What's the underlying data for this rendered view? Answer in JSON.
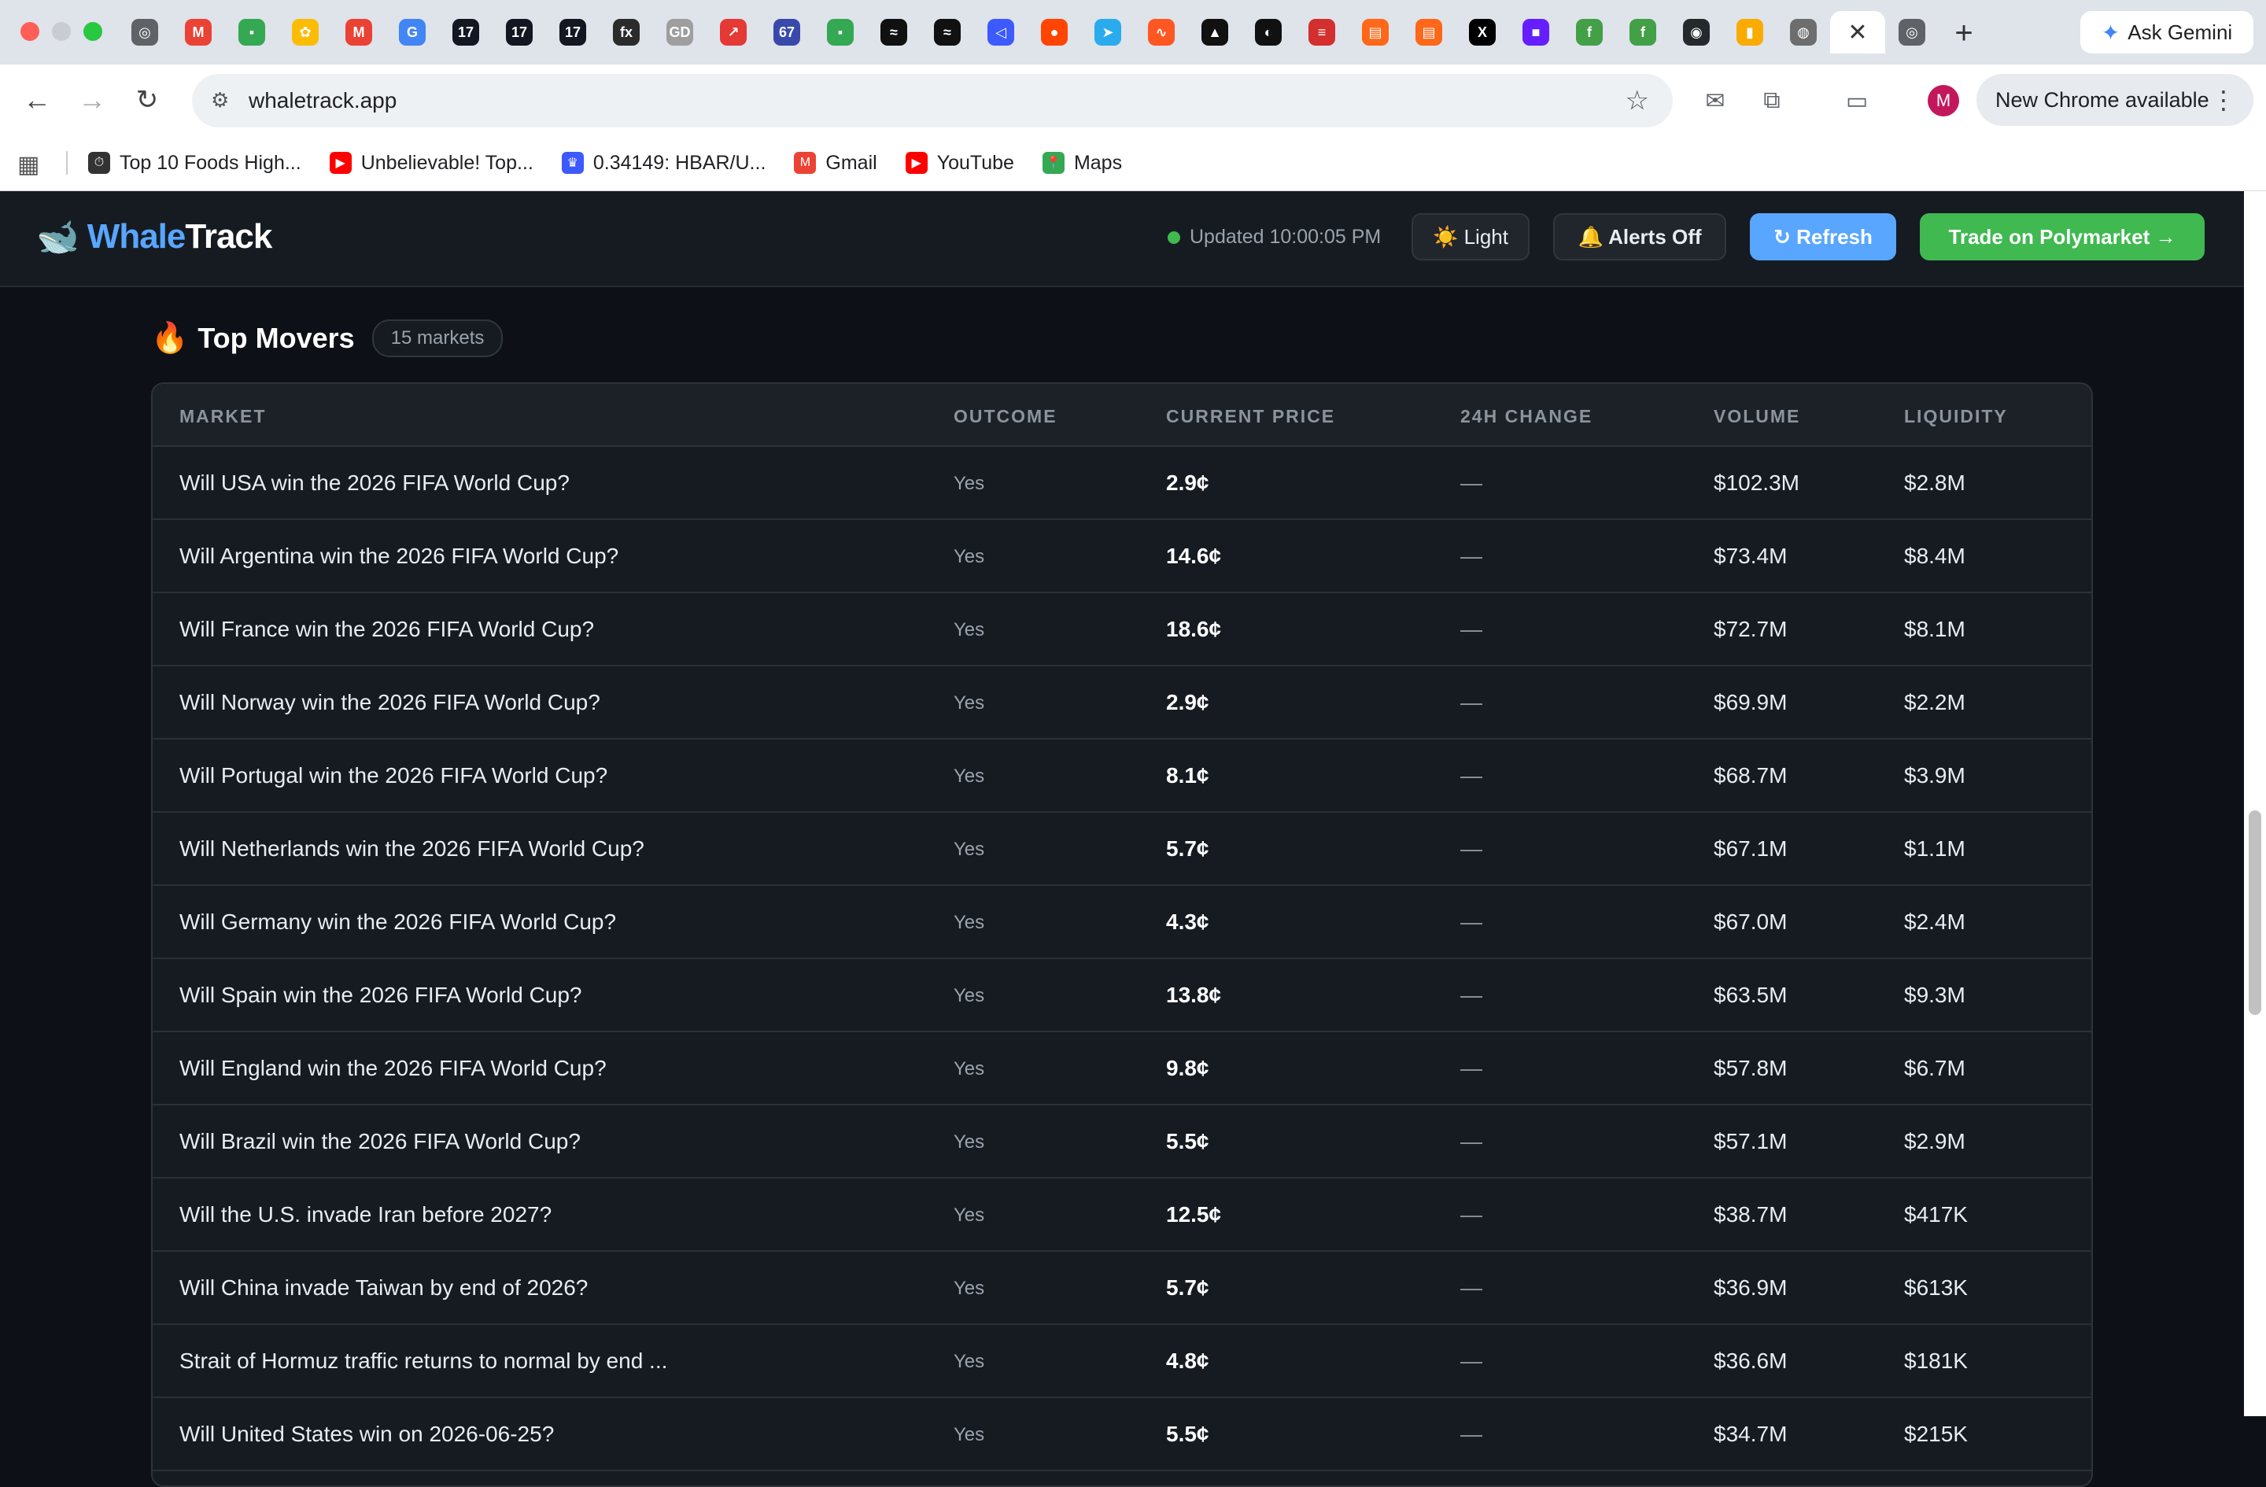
{
  "browser": {
    "tab_icons": [
      {
        "name": "chrome-icon",
        "glyph": "◎",
        "color": "#5f6368"
      },
      {
        "name": "gmail-icon",
        "glyph": "M",
        "color": "#ea4335"
      },
      {
        "name": "sheets-icon",
        "glyph": "▪",
        "color": "#34a853"
      },
      {
        "name": "photos-icon",
        "glyph": "✿",
        "color": "#fbbc05"
      },
      {
        "name": "gmail-icon",
        "glyph": "M",
        "color": "#ea4335"
      },
      {
        "name": "google-icon",
        "glyph": "G",
        "color": "#4285f4"
      },
      {
        "name": "tradingview-icon",
        "glyph": "17",
        "color": "#131722"
      },
      {
        "name": "tradingview-icon",
        "glyph": "17",
        "color": "#131722"
      },
      {
        "name": "tradingview-icon",
        "glyph": "17",
        "color": "#131722"
      },
      {
        "name": "fx-icon",
        "glyph": "fx",
        "color": "#2b2b2b"
      },
      {
        "name": "gd-icon",
        "glyph": "GD",
        "color": "#9e9e9e"
      },
      {
        "name": "arrow-app-icon",
        "glyph": "↗",
        "color": "#e53935"
      },
      {
        "name": "badge-67-icon",
        "glyph": "67",
        "color": "#3949ab"
      },
      {
        "name": "sheets-icon",
        "glyph": "▪",
        "color": "#34a853"
      },
      {
        "name": "wave-icon",
        "glyph": "≈",
        "color": "#111111"
      },
      {
        "name": "wave-icon",
        "glyph": "≈",
        "color": "#111111"
      },
      {
        "name": "blue-app-icon",
        "glyph": "◁",
        "color": "#3d5afe"
      },
      {
        "name": "reddit-icon",
        "glyph": "●",
        "color": "#ff4500"
      },
      {
        "name": "telegram-icon",
        "glyph": "➤",
        "color": "#2aabee"
      },
      {
        "name": "orange-chart-icon",
        "glyph": "∿",
        "color": "#ff5722"
      },
      {
        "name": "triangle-icon",
        "glyph": "▲",
        "color": "#111111"
      },
      {
        "name": "threads-icon",
        "glyph": "◐",
        "color": "#111111"
      },
      {
        "name": "lines-icon",
        "glyph": "≡",
        "color": "#d32f2f"
      },
      {
        "name": "substack-icon",
        "glyph": "▤",
        "color": "#ff6719"
      },
      {
        "name": "substack-icon",
        "glyph": "▤",
        "color": "#ff6719"
      },
      {
        "name": "x-icon",
        "glyph": "X",
        "color": "#000000"
      },
      {
        "name": "purple-app-icon",
        "glyph": "■",
        "color": "#651fff"
      },
      {
        "name": "green-f-icon",
        "glyph": "f",
        "color": "#43a047"
      },
      {
        "name": "green-f-icon",
        "glyph": "f",
        "color": "#43a047"
      },
      {
        "name": "github-icon",
        "glyph": "◉",
        "color": "#24292e"
      },
      {
        "name": "analytics-icon",
        "glyph": "▮",
        "color": "#f9ab00"
      },
      {
        "name": "globe-icon",
        "glyph": "◍",
        "color": "#6d6d6d"
      }
    ],
    "active_tab_close": "✕",
    "after_tab_icon": {
      "name": "chrome-icon",
      "glyph": "◎",
      "color": "#5f6368"
    },
    "new_tab": "+",
    "gemini_label": "Ask Gemini",
    "url": "whaletrack.app",
    "profile_initial": "M",
    "new_chrome_label": "New Chrome available",
    "bookmarks": [
      {
        "label": "Top 10 Foods High...",
        "icon": "timer-icon",
        "glyph": "⏱",
        "color": "#333333"
      },
      {
        "label": "Unbelievable! Top...",
        "icon": "youtube-icon",
        "glyph": "▶",
        "color": "#ff0000"
      },
      {
        "label": "0.34149: HBAR/U...",
        "icon": "crown-icon",
        "glyph": "♛",
        "color": "#3d5afe"
      },
      {
        "label": "Gmail",
        "icon": "gmail-icon",
        "glyph": "M",
        "color": "#ea4335"
      },
      {
        "label": "YouTube",
        "icon": "youtube-icon",
        "glyph": "▶",
        "color": "#ff0000"
      },
      {
        "label": "Maps",
        "icon": "maps-icon",
        "glyph": "📍",
        "color": "#34a853"
      }
    ]
  },
  "app": {
    "brand_a": "Whale",
    "brand_b": "Track",
    "updated_text": "Updated 10:00:05 PM",
    "light_label": "☀️ Light",
    "alerts_label": "🔔 Alerts Off",
    "refresh_label": "↻ Refresh",
    "trade_label": "Trade on Polymarket →",
    "section": {
      "icon": "🔥",
      "title": "Top Movers",
      "count": "15 markets"
    },
    "table": {
      "headers": {
        "market": "MARKET",
        "outcome": "OUTCOME",
        "price": "CURRENT PRICE",
        "change": "24H CHANGE",
        "volume": "VOLUME",
        "liquidity": "LIQUIDITY"
      },
      "rows": [
        {
          "market": "Will USA win the 2026 FIFA World Cup?",
          "outcome": "Yes",
          "price": "2.9¢",
          "change": "—",
          "volume": "$102.3M",
          "liquidity": "$2.8M"
        },
        {
          "market": "Will Argentina win the 2026 FIFA World Cup?",
          "outcome": "Yes",
          "price": "14.6¢",
          "change": "—",
          "volume": "$73.4M",
          "liquidity": "$8.4M"
        },
        {
          "market": "Will France win the 2026 FIFA World Cup?",
          "outcome": "Yes",
          "price": "18.6¢",
          "change": "—",
          "volume": "$72.7M",
          "liquidity": "$8.1M"
        },
        {
          "market": "Will Norway win the 2026 FIFA World Cup?",
          "outcome": "Yes",
          "price": "2.9¢",
          "change": "—",
          "volume": "$69.9M",
          "liquidity": "$2.2M"
        },
        {
          "market": "Will Portugal win the 2026 FIFA World Cup?",
          "outcome": "Yes",
          "price": "8.1¢",
          "change": "—",
          "volume": "$68.7M",
          "liquidity": "$3.9M"
        },
        {
          "market": "Will Netherlands win the 2026 FIFA World Cup?",
          "outcome": "Yes",
          "price": "5.7¢",
          "change": "—",
          "volume": "$67.1M",
          "liquidity": "$1.1M"
        },
        {
          "market": "Will Germany win the 2026 FIFA World Cup?",
          "outcome": "Yes",
          "price": "4.3¢",
          "change": "—",
          "volume": "$67.0M",
          "liquidity": "$2.4M"
        },
        {
          "market": "Will Spain win the 2026 FIFA World Cup?",
          "outcome": "Yes",
          "price": "13.8¢",
          "change": "—",
          "volume": "$63.5M",
          "liquidity": "$9.3M"
        },
        {
          "market": "Will England win the 2026 FIFA World Cup?",
          "outcome": "Yes",
          "price": "9.8¢",
          "change": "—",
          "volume": "$57.8M",
          "liquidity": "$6.7M"
        },
        {
          "market": "Will Brazil win the 2026 FIFA World Cup?",
          "outcome": "Yes",
          "price": "5.5¢",
          "change": "—",
          "volume": "$57.1M",
          "liquidity": "$2.9M"
        },
        {
          "market": "Will the U.S. invade Iran before 2027?",
          "outcome": "Yes",
          "price": "12.5¢",
          "change": "—",
          "volume": "$38.7M",
          "liquidity": "$417K"
        },
        {
          "market": "Will China invade Taiwan by end of 2026?",
          "outcome": "Yes",
          "price": "5.7¢",
          "change": "—",
          "volume": "$36.9M",
          "liquidity": "$613K"
        },
        {
          "market": "Strait of Hormuz traffic returns to normal by end ...",
          "outcome": "Yes",
          "price": "4.8¢",
          "change": "—",
          "volume": "$36.6M",
          "liquidity": "$181K"
        },
        {
          "market": "Will United States win on 2026-06-25?",
          "outcome": "Yes",
          "price": "5.5¢",
          "change": "—",
          "volume": "$34.7M",
          "liquidity": "$215K"
        }
      ]
    }
  }
}
